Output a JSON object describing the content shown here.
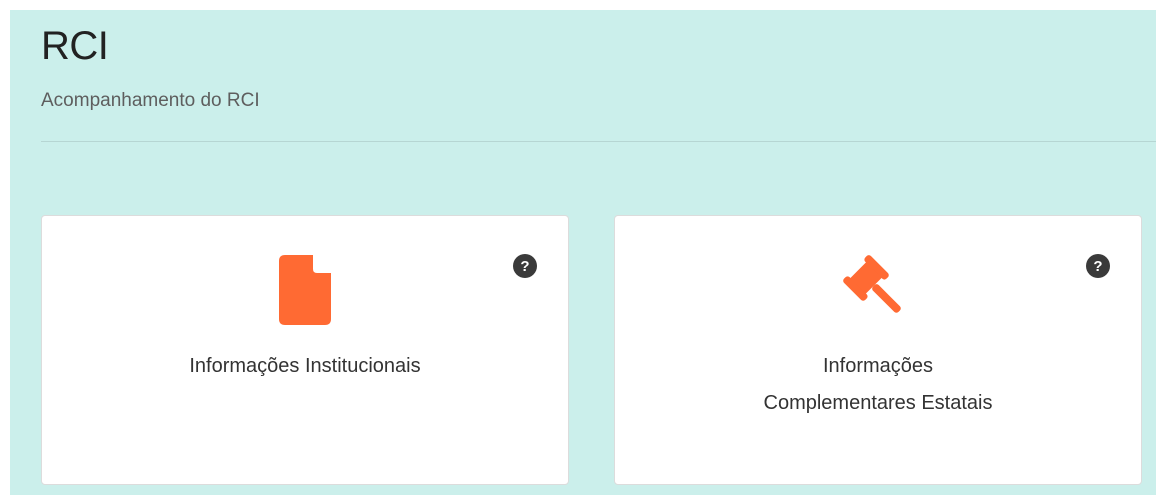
{
  "header": {
    "title": "RCI",
    "subtitle": "Acompanhamento do RCI"
  },
  "cards": [
    {
      "icon": "document-icon",
      "label_line1": "Informações Institucionais",
      "label_line2": "",
      "help": "?"
    },
    {
      "icon": "gavel-icon",
      "label_line1": "Informações",
      "label_line2": "Complementares Estatais",
      "help": "?"
    }
  ],
  "colors": {
    "background": "#cbefeb",
    "accent": "#ff6a33",
    "help_badge": "#3a3a3a"
  }
}
